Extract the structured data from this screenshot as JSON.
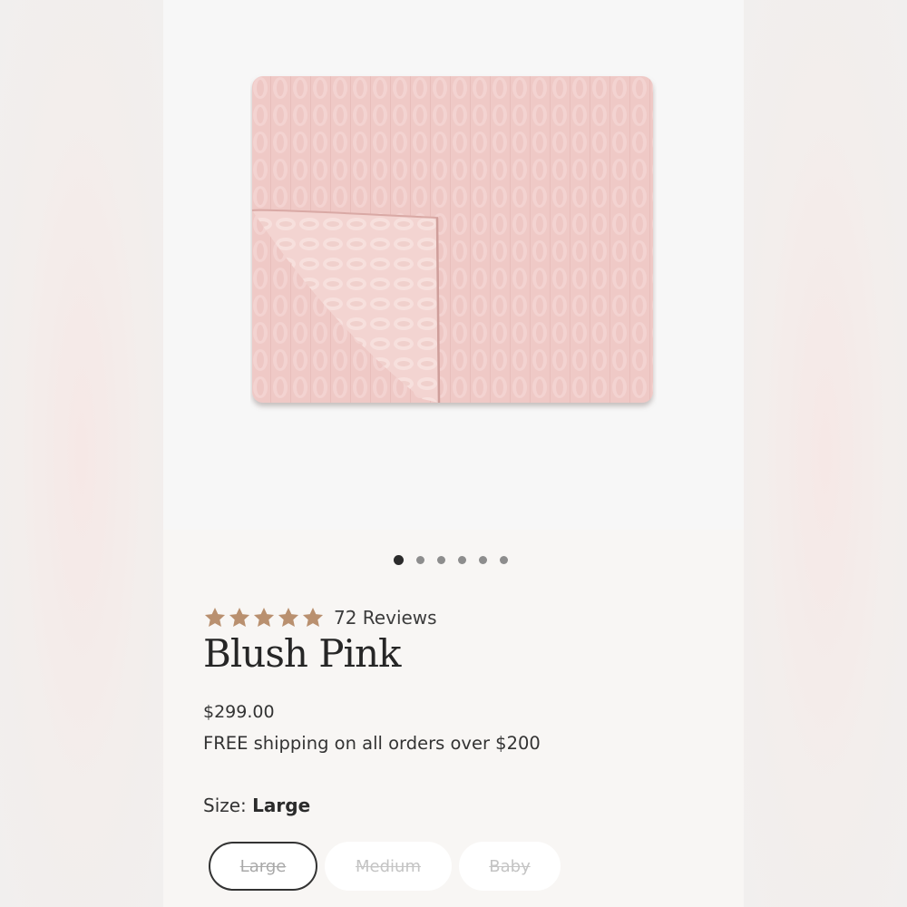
{
  "product": {
    "rating_count_text": "72 Reviews",
    "stars": 5,
    "name": "Blush Pink",
    "price": "$299.00",
    "shipping_note": "FREE shipping on all orders over $200"
  },
  "gallery": {
    "image_count": 6,
    "active_index": 0
  },
  "size": {
    "label": "Size:",
    "selected": "Large",
    "options": [
      "Large",
      "Medium",
      "Baby"
    ]
  },
  "colors": {
    "star": "#b9906f",
    "blanket": "#efc9c6",
    "text": "#262626"
  },
  "icons": [
    "star-icon",
    "product-image",
    "carousel-dot"
  ]
}
